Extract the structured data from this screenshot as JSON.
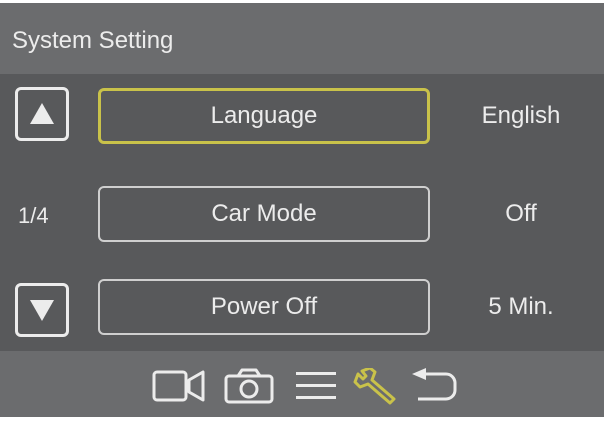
{
  "header": {
    "title": "System Setting"
  },
  "page_indicator": "1/4",
  "menu": {
    "items": [
      {
        "label": "Language",
        "value": "English",
        "selected": true
      },
      {
        "label": "Car Mode",
        "value": "Off",
        "selected": false
      },
      {
        "label": "Power Off",
        "value": "5 Min.",
        "selected": false
      }
    ]
  },
  "toolbar": {
    "icons": [
      "video-camera-icon",
      "photo-camera-icon",
      "menu-list-icon",
      "wrench-icon",
      "back-icon"
    ],
    "active_icon": "wrench-icon"
  },
  "colors": {
    "selection_accent": "#c9c24a",
    "panel": "#58595b",
    "bar": "#6b6c6e",
    "text": "#ececec"
  }
}
